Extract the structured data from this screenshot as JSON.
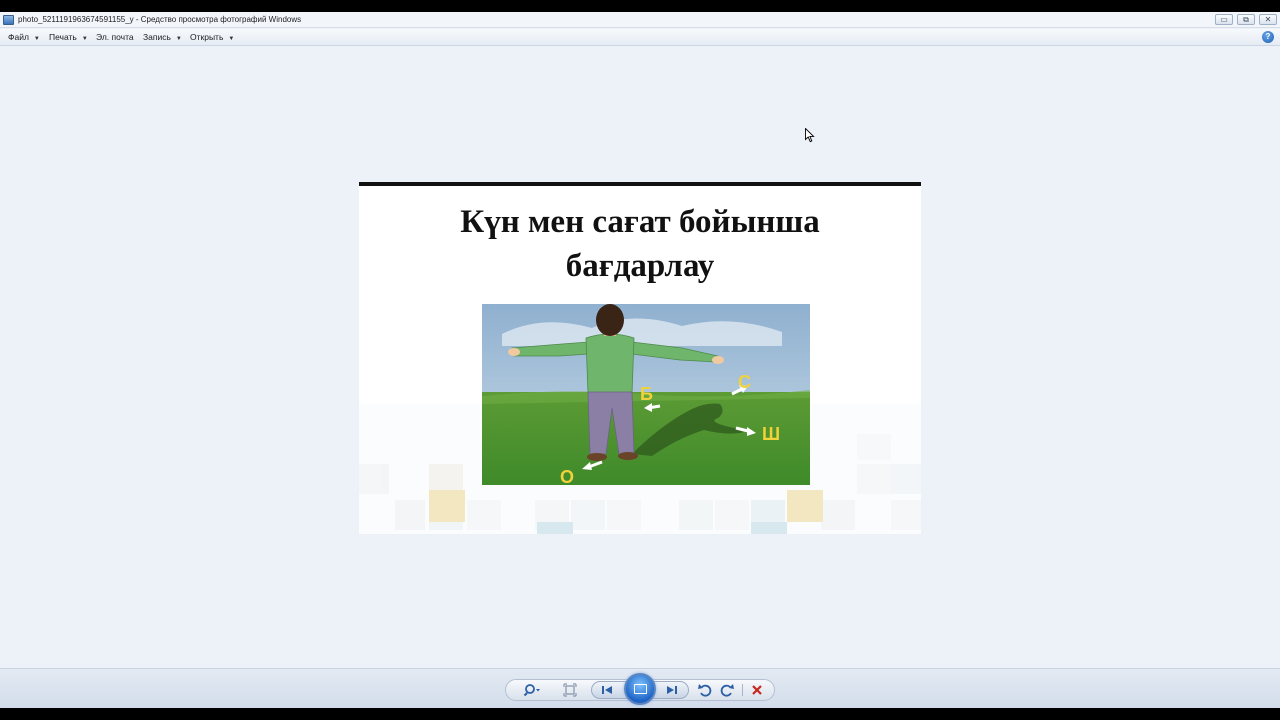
{
  "window": {
    "title": "photo_5211191963674591155_y - Средство просмотра фотографий Windows",
    "controls": {
      "minimize": "▭",
      "maximize": "⧉",
      "close": "✕"
    }
  },
  "menu": {
    "items": [
      {
        "label": "Файл",
        "has_dropdown": true
      },
      {
        "label": "Печать",
        "has_dropdown": true
      },
      {
        "label": "Эл. почта",
        "has_dropdown": false
      },
      {
        "label": "Запись",
        "has_dropdown": true
      },
      {
        "label": "Открыть",
        "has_dropdown": true
      }
    ],
    "help_label": "?"
  },
  "photo": {
    "slide_title_line1": "Күн мен сағат бойынша",
    "slide_title_line2": "бағдарлау",
    "illustration": {
      "directions": {
        "north": "С",
        "south": "О",
        "east": "Ш",
        "west": "Б"
      },
      "label_color": "#f0d23a",
      "grass_color": "#4a8f2c",
      "sky_color": "#b9d0e6"
    }
  },
  "toolbar": {
    "buttons": [
      {
        "name": "zoom-button",
        "icon": "magnifier-icon"
      },
      {
        "name": "actual-size-button",
        "icon": "fit-icon"
      },
      {
        "name": "previous-button",
        "icon": "previous-icon"
      },
      {
        "name": "slideshow-button",
        "icon": "slideshow-icon"
      },
      {
        "name": "next-button",
        "icon": "next-icon"
      },
      {
        "name": "rotate-counterclockwise-button",
        "icon": "rotate-left-icon"
      },
      {
        "name": "rotate-clockwise-button",
        "icon": "rotate-right-icon"
      },
      {
        "name": "delete-button",
        "icon": "delete-icon"
      }
    ],
    "accent_color": "#2b5fa6",
    "delete_color": "#c8261e"
  }
}
